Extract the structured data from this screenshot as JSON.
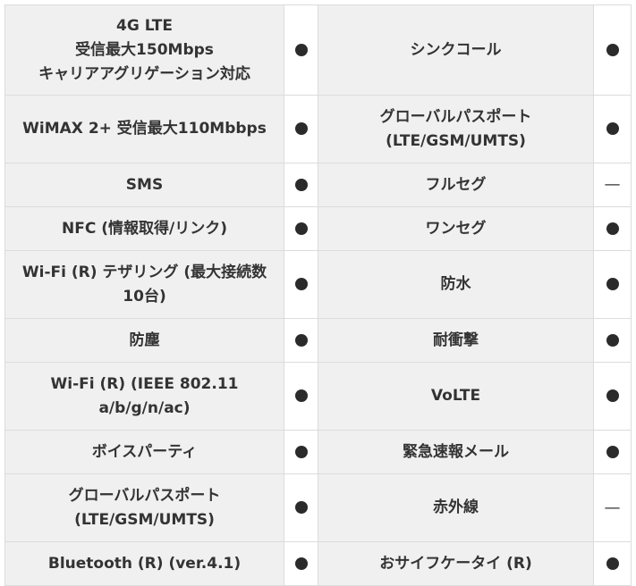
{
  "table": {
    "rows": [
      {
        "left_label": [
          "4G LTE",
          "受信最大150Mbps",
          "キャリアアグリゲーション対応"
        ],
        "left_mark": "dot",
        "right_label": [
          "シンクコール"
        ],
        "right_mark": "dot"
      },
      {
        "left_label": [
          "WiMAX 2+ 受信最大110Mbbps"
        ],
        "left_mark": "dot",
        "right_label": [
          "グローバルパスポート",
          "(LTE/GSM/UMTS)"
        ],
        "right_mark": "dot"
      },
      {
        "left_label": [
          "SMS"
        ],
        "left_mark": "dot",
        "right_label": [
          "フルセグ"
        ],
        "right_mark": "dash"
      },
      {
        "left_label": [
          "NFC (情報取得/リンク)"
        ],
        "left_mark": "dot",
        "right_label": [
          "ワンセグ"
        ],
        "right_mark": "dot"
      },
      {
        "left_label": [
          "Wi-Fi (R) テザリング (最大接続数",
          "10台)"
        ],
        "left_mark": "dot",
        "right_label": [
          "防水"
        ],
        "right_mark": "dot"
      },
      {
        "left_label": [
          "防塵"
        ],
        "left_mark": "dot",
        "right_label": [
          "耐衝撃"
        ],
        "right_mark": "dot"
      },
      {
        "left_label": [
          "Wi-Fi (R) (IEEE 802.11",
          "a/b/g/n/ac)"
        ],
        "left_mark": "dot",
        "right_label": [
          "VoLTE"
        ],
        "right_mark": "dot"
      },
      {
        "left_label": [
          "ボイスパーティ"
        ],
        "left_mark": "dot",
        "right_label": [
          "緊急速報メール"
        ],
        "right_mark": "dot"
      },
      {
        "left_label": [
          "グローバルパスポート",
          "(LTE/GSM/UMTS)"
        ],
        "left_mark": "dot",
        "right_label": [
          "赤外線"
        ],
        "right_mark": "dash"
      },
      {
        "left_label": [
          "Bluetooth (R) (ver.4.1)"
        ],
        "left_mark": "dot",
        "right_label": [
          "おサイフケータイ (R)"
        ],
        "right_mark": "dot"
      }
    ],
    "dash_symbol": "—",
    "colors": {
      "label_bg": "#f0f0f0",
      "mark_bg": "#ffffff",
      "border": "#dcdcdc",
      "text": "#333333",
      "dot": "#2b2b2b"
    }
  }
}
